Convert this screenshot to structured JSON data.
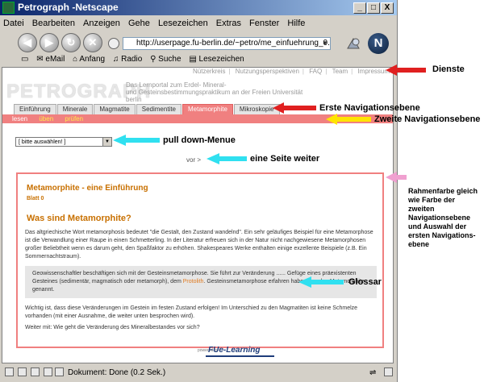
{
  "window": {
    "title": "Petrograph -Netscape",
    "controls": [
      "_",
      "□",
      "X"
    ]
  },
  "menubar": [
    "Datei",
    "Bearbeiten",
    "Anzeigen",
    "Gehe",
    "Lesezeichen",
    "Extras",
    "Fenster",
    "Hilfe"
  ],
  "url": "http://userpage.fu-berlin.de/~petro/me_einfuehrung_0.htm",
  "personal_toolbar": [
    "eMail",
    "Anfang",
    "Radio",
    "Suche",
    "Lesezeichen"
  ],
  "site": {
    "service_links": [
      "Nützerkreis",
      "Nutzungsperspektiven",
      "FAQ",
      "Team",
      "Impressum"
    ],
    "logo": "PETROGRAPH",
    "tagline_line1": "Das Lernportal zum Erdel- Mineral-",
    "tagline_line2": "und Gesteinsbestimmungspraktikum an der Freien Universität berlin",
    "nav1": [
      {
        "label": "Einführung",
        "active": false
      },
      {
        "label": "Minerale",
        "active": false
      },
      {
        "label": "Magmatite",
        "active": false
      },
      {
        "label": "Sedimentite",
        "active": false
      },
      {
        "label": "Metamorphite",
        "active": true
      },
      {
        "label": "Mikroskopie",
        "active": false
      }
    ],
    "nav2": [
      {
        "label": "lesen",
        "active": true
      },
      {
        "label": "üben",
        "active": false
      },
      {
        "label": "prüfen",
        "active": false
      }
    ],
    "dropdown_value": "[ bitte auswählen! ]",
    "next_link": "vor >",
    "content": {
      "title": "Metamorphite - eine Einführung",
      "sheet": "Blatt 0",
      "heading": "Was sind Metamorphite?",
      "para1": "Das altgriechische Wort metamorphosis bedeutet \"die Gestalt, den Zustand wandelnd\". Ein sehr geläufiges Beispiel für eine Metamorphose ist die Verwandlung einer Raupe in einen Schmetterling. In der Literatur erfreuen sich in der Natur nicht nachgewiesene Metamorphosen großer Beliebtheit wenn es darum geht, den Spaßfaktor zu erhöhen. Shakespeares Werke enthalten einige exzellente Beispiele (z.B. Ein Sommernachtstraum).",
      "para2_before": "Geowissenschaftler beschäftigen sich mit der Gesteinsmetamorphose. Sie führt zur Veränderung ...... Gefüge eines präexistenten Gesteines (sedimentär, magmatisch oder metamorph), dem ",
      "para2_link": "Protolith",
      "para2_after": ". Gesteinsmetamorphose erfahren haben, werden Metamorphite genannt.",
      "para3": "Wichtig ist, dass diese Veränderungen im Gestein im festen Zustand erfolgen! Im Unterschied zu den Magmatiten ist keine Schmelze vorhanden (mit einer Ausnahme, die weiter unten besprochen wird).",
      "para4": "Weiter mit: Wie geht die Veränderung des Mineralbestandes vor sich?"
    },
    "powered_by": "powered by",
    "footer_logo": "FUe-Learning"
  },
  "status": "Dokument: Done (0.2 Sek.)",
  "annotations": {
    "dienste": "Dienste",
    "nav1": "Erste Navigationsebene",
    "nav2": "Zweite Navigationsebene",
    "pulldown": "pull down-Menue",
    "next": "eine Seite weiter",
    "glossar": "Glossar",
    "frame_color": "Rahmenfarbe gleich wie Farbe der zweiten Navigationsebene und Auswahl der ersten Navigations-ebene"
  },
  "colors": {
    "accent": "#f08080",
    "sub_nav_text": "#ffe84d",
    "heading_orange": "#c87000",
    "arrow_red": "#e02020",
    "arrow_yellow": "#ffe400",
    "arrow_cyan": "#30e0f0",
    "arrow_pink": "#f0a0d0"
  }
}
